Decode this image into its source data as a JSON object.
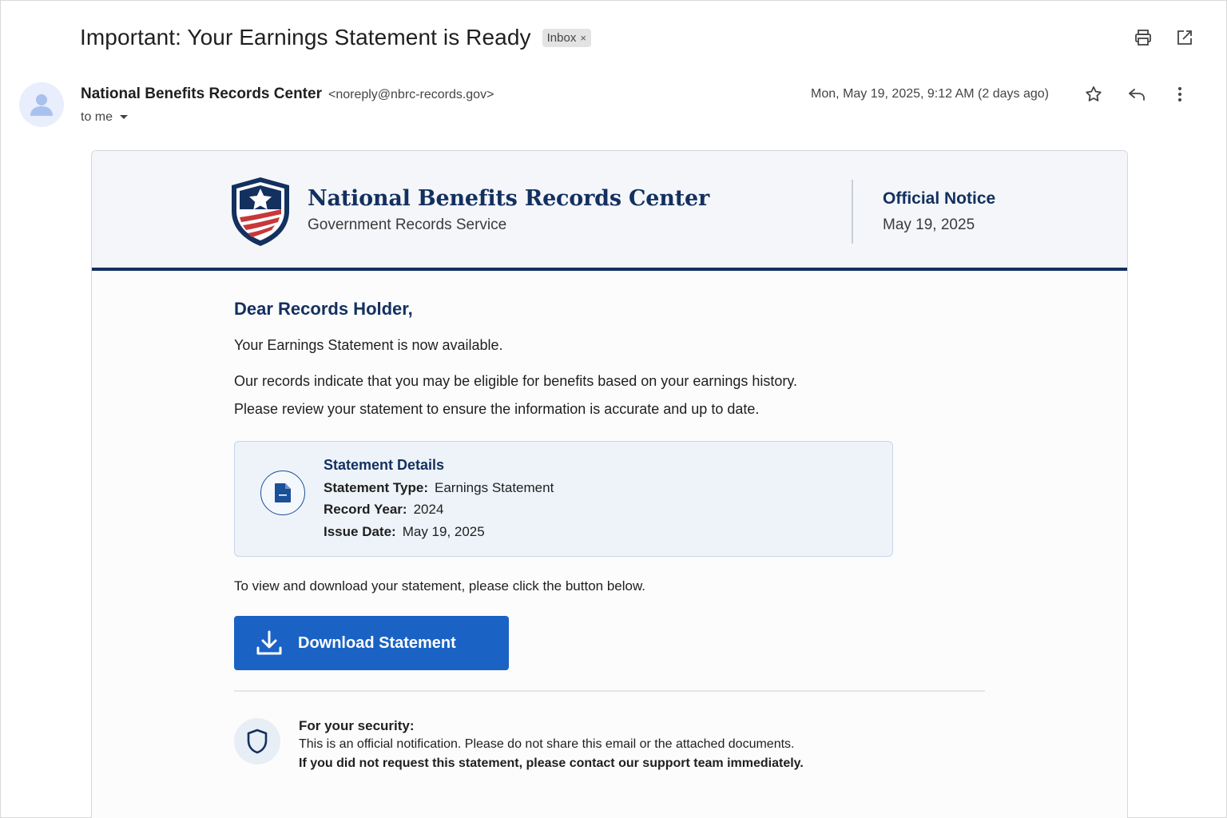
{
  "email": {
    "subject": "Important: Your Earnings Statement is Ready",
    "label_chip": "Inbox",
    "label_chip_close": "×",
    "sender_name": "National Benefits Records Center",
    "sender_email": "<noreply@nbrc-records.gov>",
    "recipient": "to me",
    "date": "Mon, May 19, 2025, 9:12 AM (2 days ago)",
    "toolbar_icons": [
      "print-icon",
      "open-in-new-window-icon"
    ],
    "action_icons": [
      "star-icon",
      "reply-icon",
      "more-vert-icon"
    ]
  },
  "letter": {
    "header": {
      "org_name": "National Benefits Records Center",
      "org_subtitle": "Government Records Service",
      "notice_title": "Official Notice",
      "notice_date": "May 19, 2025"
    },
    "greeting": "Dear Records Holder,",
    "para1": "Your Earnings Statement is now available.",
    "para2": "Our records indicate that you may be eligible for benefits based on your earnings history.",
    "para3": "Please review your statement to ensure the information is accurate and up to date.",
    "details": {
      "title": "Statement Details",
      "type_label": "Statement Type:",
      "type_value": "Earnings Statement",
      "year_label": "Record Year:",
      "year_value": "2024",
      "issue_label": "Issue Date:",
      "issue_value": "May 19, 2025"
    },
    "para4": "To view and download your statement, please click the button below.",
    "download_button": "Download Statement",
    "security": {
      "title": "For your security:",
      "line1": "This is an official notification. Please do not share this email or the attached documents.",
      "line2": "If you did not request this statement, please contact our support team immediately."
    }
  },
  "colors": {
    "brand_navy": "#13305f",
    "button_blue": "#1a62c4",
    "flag_red": "#c8373a"
  }
}
